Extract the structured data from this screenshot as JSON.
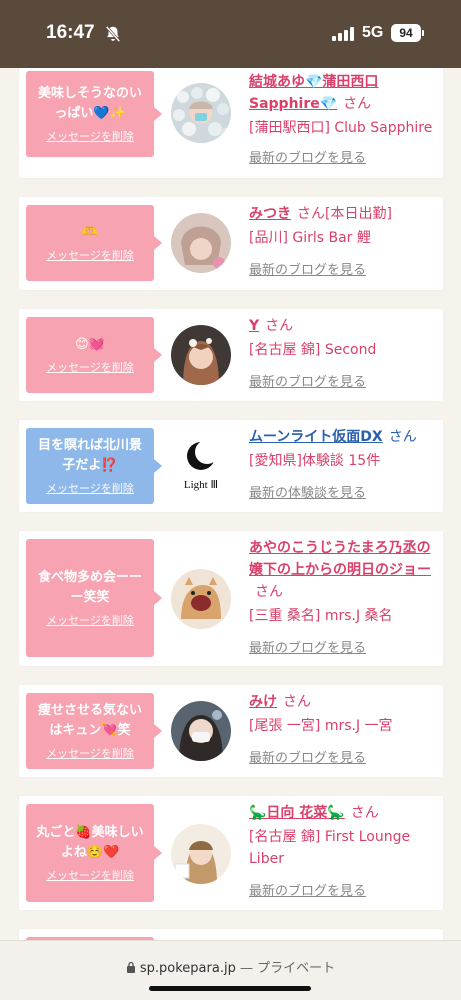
{
  "status_bar": {
    "time": "16:47",
    "network": "5G",
    "battery": "94"
  },
  "cards": [
    {
      "bubble_color": "pink",
      "message": "美味しそうなのいっぱい💙✨",
      "delete_label": "メッセージを削除",
      "name": "結城あゆ💎蒲田西口Sapphire💎",
      "san": "さん",
      "shop": "[蒲田駅西口] Club Sapphire",
      "link": "最新のブログを見る"
    },
    {
      "bubble_color": "pink",
      "message": "🫶",
      "delete_label": "メッセージを削除",
      "name": "みつき",
      "san": "さん[本日出勤]",
      "shop": "[品川] Girls Bar 鯉",
      "link": "最新のブログを見る"
    },
    {
      "bubble_color": "pink",
      "message": "😊💓",
      "delete_label": "メッセージを削除",
      "name": "Y",
      "san": "さん",
      "shop": "[名古屋 錦] Second",
      "link": "最新のブログを見る"
    },
    {
      "bubble_color": "blue",
      "message": "目を瞑れば北川景子だよ⁉️",
      "delete_label": "メッセージを削除",
      "name": "ムーンライト仮面DX",
      "san": "さん",
      "shop": "[愛知県]体験談 15件",
      "link": "最新の体験談を見る",
      "logo_text": "Light Ⅲ"
    },
    {
      "bubble_color": "pink",
      "message": "食べ物多め会ーーー笑笑",
      "delete_label": "メッセージを削除",
      "name": "あやのこうじうたまろ乃丞の嬢下の上からの明日のジョー",
      "san": "さん",
      "shop": "[三重 桑名] mrs.J 桑名",
      "link": "最新のブログを見る"
    },
    {
      "bubble_color": "pink",
      "message": "痩せさせる気ないはキュン💘笑",
      "delete_label": "メッセージを削除",
      "name": "みけ",
      "san": "さん",
      "shop": "[尾張 一宮] mrs.J 一宮",
      "link": "最新のブログを見る"
    },
    {
      "bubble_color": "pink",
      "message": "丸ごと🍓美味しいよね☺️❤️",
      "delete_label": "メッセージを削除",
      "name": "🦕日向 花菜🦕",
      "san": "さん",
      "shop": "[名古屋 錦] First Lounge Liber",
      "link": "最新のブログを見る"
    }
  ],
  "url_bar": {
    "domain": "sp.pokepara.jp",
    "separator": "—",
    "mode": "プライベート"
  },
  "colors": {
    "pink": "#f7a3b1",
    "blue": "#8fb8ea",
    "name_pink": "#d9406a",
    "name_blue": "#2a5fb0"
  }
}
